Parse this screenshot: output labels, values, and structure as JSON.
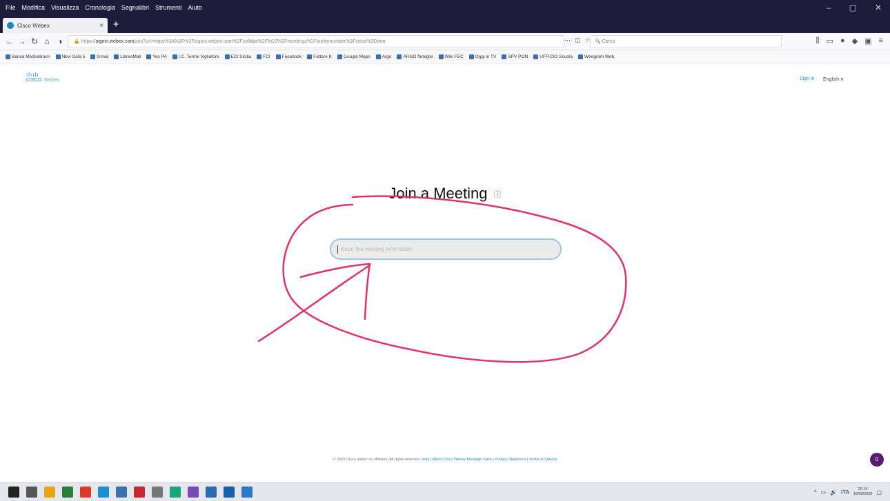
{
  "browser": {
    "menus": [
      "File",
      "Modifica",
      "Visualizza",
      "Cronologia",
      "Segnalibri",
      "Strumenti",
      "Aiuto"
    ],
    "window_controls": [
      "–",
      "▢",
      "✕"
    ],
    "tab_title": "Cisco Webex",
    "tab_close": "×",
    "new_tab": "+",
    "url_prefix": "https://",
    "url_host": "signin.webex.com",
    "url_rest": "/join?url=https%3A%2F%2Fsignin.webex.com%2Fcollabs%2F%23%2Fmeetings%2Fjoinbynumber%3Fcisco%3Dtrue",
    "url_more": "···",
    "search_placeholder": "Cerca",
    "bookmarks": [
      "Banca Mediolanum",
      "Nevi Cola 5",
      "Gmail",
      "LibreoMail",
      "Yes PA",
      "I.C. Terme Vigliatore",
      "ECI Sicilia",
      "FCI",
      "Facebook",
      "Fattore K",
      "Google Maps",
      "Argo",
      "ARGO famiglie",
      "Wiki FEC",
      "Oggi in TV",
      "SPV PON",
      "UFFICIO Scuola",
      "Weegram Web"
    ]
  },
  "page": {
    "logo_bars": "ılıılı",
    "logo_word": "CISCO",
    "logo_product": "Webex",
    "signin_label": "Sign in",
    "language_label": "English",
    "language_chevron": "∨",
    "title": "Join a Meeting",
    "info_icon": "ⓘ",
    "input_value": "",
    "input_placeholder": "Enter the meeting information",
    "footer_text": "© 2020 Cisco and/or its affiliates. All rights reserved.",
    "footer_links": [
      "Help",
      "About Cisco Webex Meetings Suite",
      "Privacy Statement",
      "Terms of Service"
    ],
    "chat_badge": "0"
  },
  "annotation": {
    "color": "#e0316f"
  },
  "taskbar": {
    "icon_colors": [
      "#222",
      "#555",
      "#e8a317",
      "#2a7d3a",
      "#d73b2a",
      "#1d8ed1",
      "#3a6fb0",
      "#c5282f",
      "#777",
      "#1aa67a",
      "#7a4bb5",
      "#2b6cb0",
      "#1560a8",
      "#2a78c9"
    ],
    "tray_icons": [
      "^",
      "▭",
      "🔊",
      "ITA"
    ],
    "time": "20:14",
    "date": "18/03/2020"
  }
}
